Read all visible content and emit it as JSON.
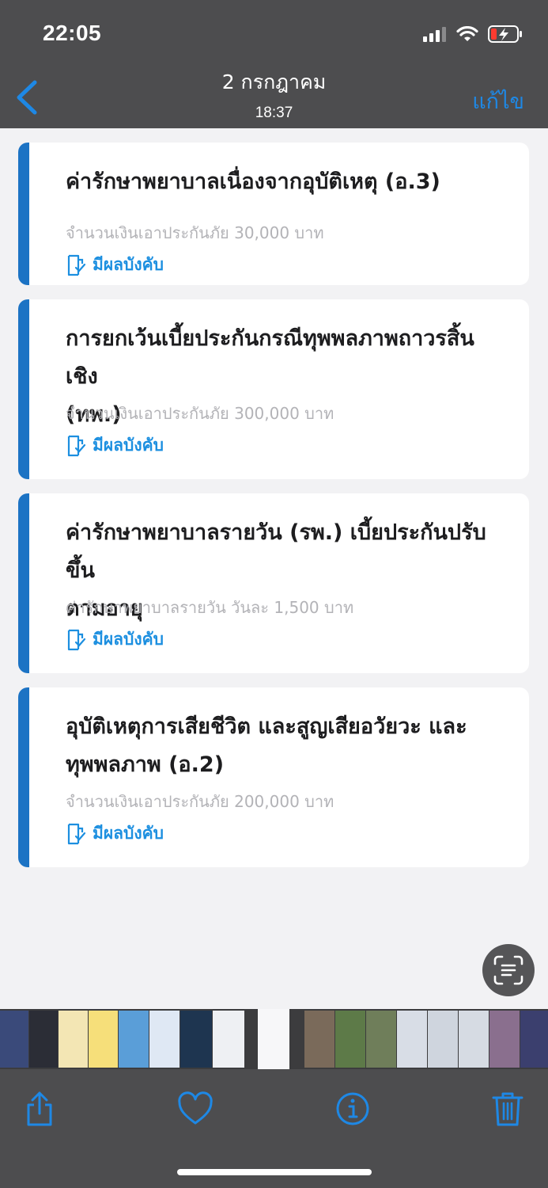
{
  "status_bar": {
    "time": "22:05"
  },
  "nav": {
    "title": "2 กรกฎาคม",
    "subtitle": "18:37",
    "edit_label": "แก้ไข",
    "back_icon": "chevron-left-icon"
  },
  "cards": [
    {
      "title_lines": [
        "ค่ารักษาพยาบาลเนื่องจากอุบัติเหตุ (อ.3)"
      ],
      "description": "จำนวนเงินเอาประกันภัย 30,000 บาท",
      "status": "มีผลบังคับ"
    },
    {
      "title_lines": [
        "การยกเว้นเบี้ยประกันกรณีทุพพลภาพถาวรสิ้นเชิง",
        "(ทพ.)"
      ],
      "description": "จำนวนเงินเอาประกันภัย 300,000 บาท",
      "status": "มีผลบังคับ"
    },
    {
      "title_lines": [
        "ค่ารักษาพยาบาลรายวัน (รพ.) เบี้ยประกันปรับขึ้น",
        "ตามอายุ"
      ],
      "description": "ค่ารักษาพยาบาลรายวัน วันละ 1,500 บาท",
      "status": "มีผลบังคับ"
    },
    {
      "title_lines": [
        "อุบัติเหตุการเสียชีวิต และสูญเสียอวัยวะ และ",
        "ทุพพลภาพ (อ.2)"
      ],
      "description": "จำนวนเงินเอาประกันภัย 200,000 บาท",
      "status": "มีผลบังคับ"
    }
  ],
  "toolbar": {
    "icons": [
      "share-icon",
      "heart-icon",
      "info-icon",
      "trash-icon"
    ]
  },
  "colors": {
    "accent": "#1c73c4",
    "link": "#1e88e5",
    "status": "#1c8fe0",
    "bar_bg": "#4d4d4f",
    "page_bg": "#f2f2f4"
  }
}
